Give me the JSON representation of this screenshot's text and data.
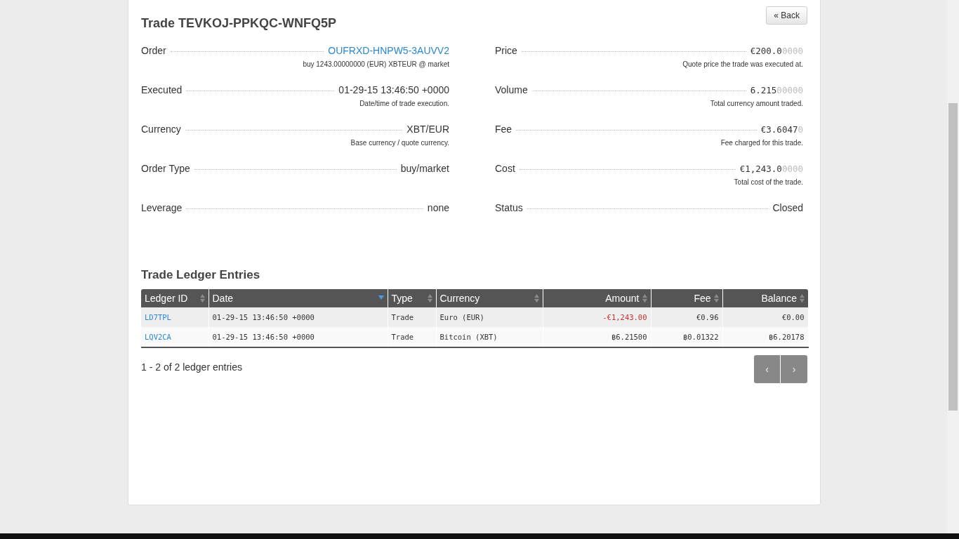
{
  "title": "Trade TEVKOJ-PPKQC-WNFQ5P",
  "back_button": "« Back",
  "details_left": [
    {
      "label": "Order",
      "value": "OUFRXD-HNPW5-3AUVV2",
      "kind": "link",
      "note": "buy 1243.00000000 (EUR) XBTEUR @ market"
    },
    {
      "label": "Executed",
      "value": "01-29-15 13:46:50 +0000",
      "kind": "text",
      "note": "Date/time of trade execution."
    },
    {
      "label": "Currency",
      "value": "XBT/EUR",
      "kind": "text",
      "note": "Base currency / quote currency."
    },
    {
      "label": "Order Type",
      "value": "buy/market",
      "kind": "text"
    },
    {
      "label": "Leverage",
      "value": "none",
      "kind": "text"
    }
  ],
  "details_right": [
    {
      "label": "Price",
      "value": "€200.0",
      "value_dim": "0000",
      "kind": "number",
      "note": "Quote price the trade was executed at."
    },
    {
      "label": "Volume",
      "value": "6.215",
      "value_dim": "00000",
      "kind": "number",
      "note": "Total currency amount traded."
    },
    {
      "label": "Fee",
      "value": "€3.6047",
      "value_dim": "0",
      "kind": "number",
      "note": "Fee charged for this trade."
    },
    {
      "label": "Cost",
      "value": "€1,243.0",
      "value_dim": "0000",
      "kind": "number",
      "note": "Total cost of the trade."
    },
    {
      "label": "Status",
      "value": "Closed",
      "kind": "text"
    }
  ],
  "ledger_title": "Trade Ledger Entries",
  "table": {
    "columns": [
      {
        "label": "Ledger ID",
        "sorted": false
      },
      {
        "label": "Date",
        "sorted": true
      },
      {
        "label": "Type",
        "sorted": false
      },
      {
        "label": "Currency",
        "sorted": false
      },
      {
        "label": "Amount",
        "sorted": false
      },
      {
        "label": "Fee",
        "sorted": false
      },
      {
        "label": "Balance",
        "sorted": false
      }
    ],
    "rows": [
      {
        "ledger_id": "LD7TPL",
        "date": "01-29-15 13:46:50 +0000",
        "type": "Trade",
        "currency": "Euro (EUR)",
        "amount": "-€1,243.00",
        "negative": true,
        "fee": "€0.96",
        "balance": "€0.00"
      },
      {
        "ledger_id": "LQV2CA",
        "date": "01-29-15 13:46:50 +0000",
        "type": "Trade",
        "currency": "Bitcoin (XBT)",
        "amount": "฿6.21500",
        "negative": false,
        "fee": "฿0.01322",
        "balance": "฿6.20178"
      }
    ]
  },
  "entries_summary": "1 - 2 of 2 ledger entries",
  "pagination": [
    "‹",
    "›"
  ]
}
